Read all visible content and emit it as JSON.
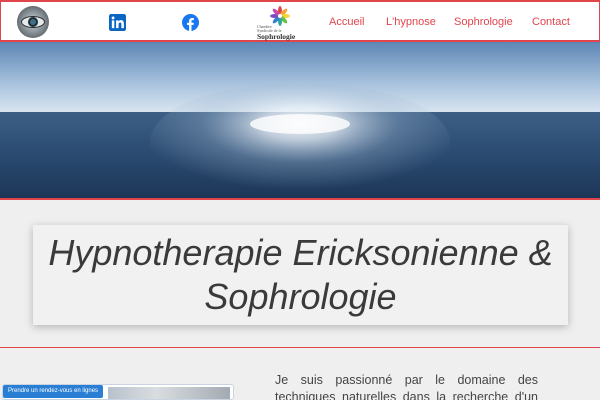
{
  "header": {
    "nav": {
      "accueil": "Accueil",
      "hypnose": "L'hypnose",
      "sophrologie": "Sophrologie",
      "contact": "Contact"
    },
    "chambre_logo": {
      "line1": "Chambre",
      "line2": "Syndicale de la",
      "line3": "Sophrologie"
    },
    "social_icons": [
      "linkedin-icon",
      "facebook-icon"
    ]
  },
  "hero": {
    "image": "sea-horizon-sunlight"
  },
  "main": {
    "title": "Hypnotherapie Ericksonienne & Sophrologie",
    "intro": "Je suis passionné par le domaine des techniques naturelles dans la recherche d'un"
  },
  "widget": {
    "label": "Prendre un rendez-vous en lignes"
  },
  "colors": {
    "accent": "#e0454c",
    "linkedin": "#0a66c2",
    "facebook": "#1877f2",
    "background": "#f0efef",
    "widget_blue": "#2a7fd4"
  }
}
